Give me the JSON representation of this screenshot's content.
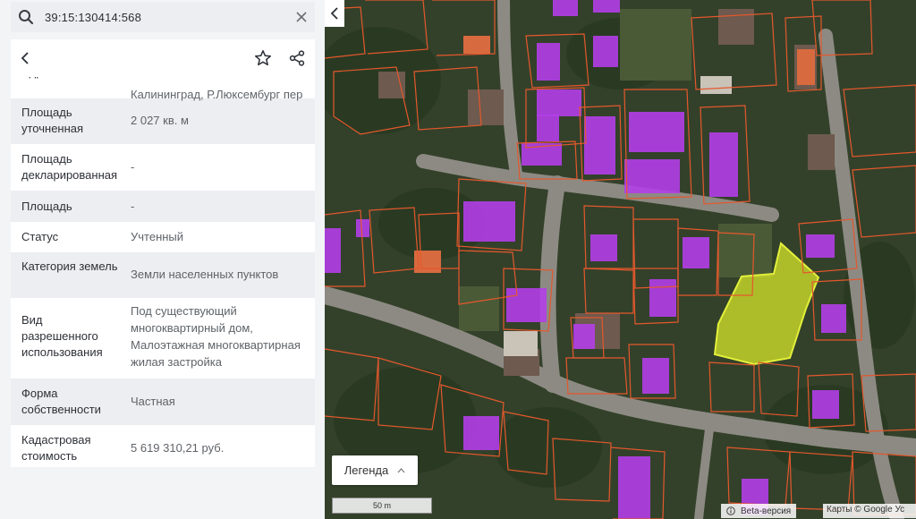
{
  "search": {
    "query": "39:15:130414:568"
  },
  "panel": {
    "address_partial": "Адрес",
    "address_fragment": "Калининград, Р.Люксембург пер",
    "properties": [
      {
        "label": "Площадь уточненная",
        "value": "2 027 кв. м"
      },
      {
        "label": "Площадь декларированная",
        "value": "-"
      },
      {
        "label": "Площадь",
        "value": "-"
      },
      {
        "label": "Статус",
        "value": "Учтенный"
      },
      {
        "label": "Категория земель",
        "value": "Земли населенных пунктов"
      },
      {
        "label": "Вид разрешенного использования",
        "value": "Под существующий многоквартирный дом, Малоэтажная многоквартирная жилая застройка"
      },
      {
        "label": "Форма собственности",
        "value": "Частная"
      },
      {
        "label": "Кадастровая стоимость",
        "value": "5 619 310,21 руб."
      }
    ]
  },
  "map": {
    "legend_label": "Легенда",
    "scale_label": "50 m",
    "beta_label": "Beta-версия",
    "attribution": "Карты © Google  Ус",
    "colors": {
      "parcel_border": "#e4582d",
      "building_fill": "#b23ee8",
      "selected_fill": "#d7e62a",
      "selected_border": "#e3f03a"
    }
  }
}
